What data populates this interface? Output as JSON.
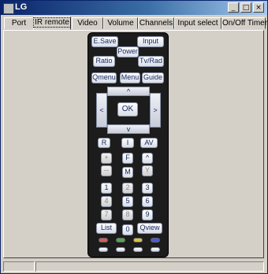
{
  "window": {
    "title": "LG",
    "minimize": "_",
    "maximize": "□",
    "close": "×"
  },
  "tabs": [
    {
      "label": "Port"
    },
    {
      "label": "IR remote"
    },
    {
      "label": "Video"
    },
    {
      "label": "Volume"
    },
    {
      "label": "Channels"
    },
    {
      "label": "Input select"
    },
    {
      "label": "On/Off Timer"
    }
  ],
  "active_tab": "IR remote",
  "remote": {
    "esave": "E.Save",
    "input": "Input",
    "power": "Power",
    "ratio": "Ratio",
    "tvrad": "Tv/Rad",
    "qmenu": "Qmenu",
    "menu": "Menu",
    "guide": "Guide",
    "up": "^",
    "down": "v",
    "left": "<",
    "right": ">",
    "ok": "OK",
    "r": "R",
    "i": "I",
    "av": "AV",
    "plus": "+",
    "f": "F",
    "caret": "^",
    "minus": "--",
    "m": "M",
    "y": "Y",
    "n1": "1",
    "n2": "2",
    "n3": "3",
    "n4": "4",
    "n5": "5",
    "n6": "6",
    "n7": "7",
    "n8": "8",
    "n9": "9",
    "n0": "0",
    "list": "List",
    "qview": "Qview"
  },
  "colors": {
    "red": "#d85a5a",
    "green": "#4fa84f",
    "yellow": "#d8c24a",
    "blue": "#4a5ad8"
  }
}
